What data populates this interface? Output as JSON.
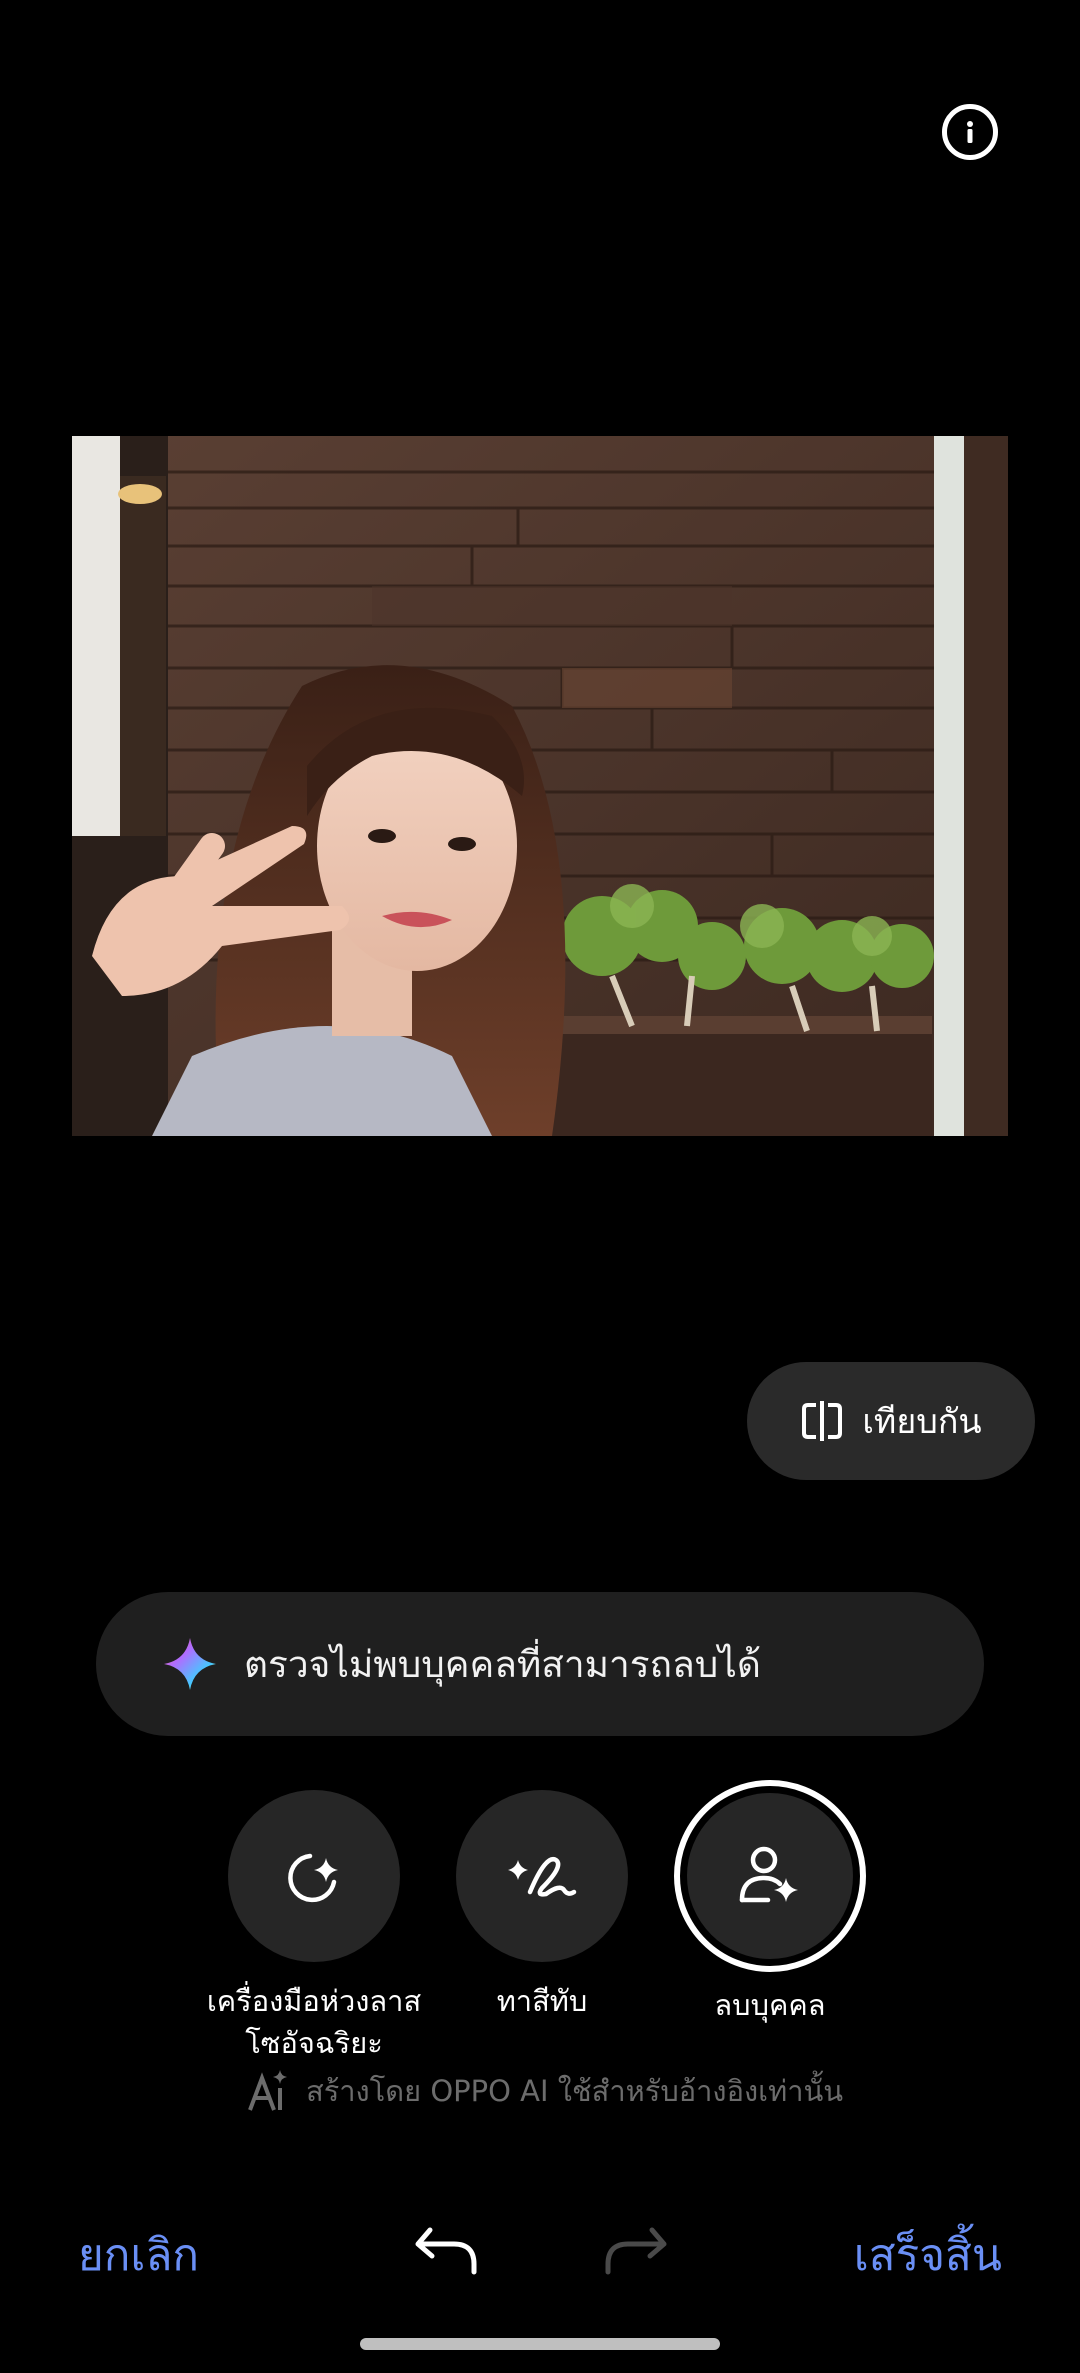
{
  "header": {
    "info_icon": "info-icon"
  },
  "photo": {
    "description_icon": "image-preview"
  },
  "compare": {
    "label": "เทียบกัน",
    "icon": "compare-icon"
  },
  "notice": {
    "text": "ตรวจไม่พบบุคคลที่สามารถลบได้",
    "icon": "ai-sparkle-icon"
  },
  "tools": [
    {
      "label": "เครื่องมือห่วงลาส\nโซอัจฉริยะ",
      "icon": "smart-lasso-icon",
      "selected": false
    },
    {
      "label": "ทาสีทับ",
      "icon": "brush-sparkle-icon",
      "selected": false
    },
    {
      "label": "ลบบุคคล",
      "icon": "remove-person-icon",
      "selected": true
    }
  ],
  "ai_note": {
    "text": "สร้างโดย OPPO AI ใช้สำหรับอ้างอิงเท่านั้น",
    "icon": "ai-generated-icon"
  },
  "bottom_bar": {
    "cancel_label": "ยกเลิก",
    "done_label": "เสร็จสิ้น",
    "undo_icon": "undo-icon",
    "redo_icon": "redo-icon"
  },
  "colors": {
    "accent": "#6a8ff5",
    "background": "#000000",
    "pill": "#1f1f1f"
  }
}
